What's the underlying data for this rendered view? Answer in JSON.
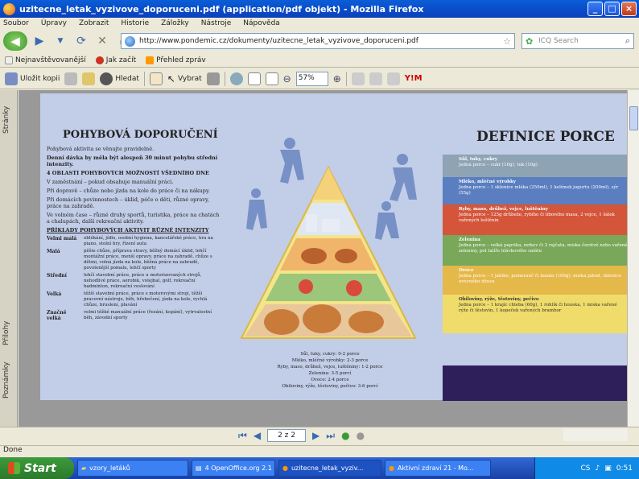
{
  "window": {
    "title": "uzitecne_letak_vyzivove_doporuceni.pdf (application/pdf objekt) - Mozilla Firefox",
    "controls": [
      "_",
      "□",
      "×"
    ]
  },
  "menu": [
    "Soubor",
    "Úpravy",
    "Zobrazit",
    "Historie",
    "Záložky",
    "Nástroje",
    "Nápověda"
  ],
  "nav": {
    "url": "http://www.pondemic.cz/dokumenty/uzitecne_letak_vyzivove_doporuceni.pdf",
    "search_placeholder": "ICQ Search"
  },
  "bookmarks": [
    "Nejnavštěvovanější",
    "Jak začít",
    "Přehled zpráv"
  ],
  "pdf_toolbar": {
    "save_copy": "Uložit kopii",
    "search": "Hledat",
    "select": "Vybrat",
    "zoom": "57%"
  },
  "sidebar_tabs": [
    "Stránky",
    "Přílohy",
    "Poznámky"
  ],
  "pager": {
    "page": "2 z 2"
  },
  "status": "Done",
  "pdf": {
    "left_heading": "POHYBOVÁ DOPORUČENÍ",
    "left_intro": [
      "Pohybová aktivita se věnujte pravidelně.",
      "Denní dávka by měla být alespoň 30 minut pohybu střední intenzity."
    ],
    "left_oblasti_title": "4 OBLASTI POHYBOVÝCH MOŽNOSTÍ VŠEDNÍHO DNE",
    "left_oblasti": [
      "V zaměstnání – pokud obsahuje manuální práci.",
      "Při dopravě – chůze nebo jízda na kole do práce či na nákupy.",
      "Při domácích povinnostech – úklid, péče o děti, různé opravy, práce na zahradě.",
      "Ve volném čase – různé druhy sportů, turistika, práce na chatách a chalupách, další rekreační aktivity."
    ],
    "left_examples_title": "PŘÍKLADY POHYBOVÝCH AKTIVIT RŮZNÉ INTENZITY",
    "activities": [
      {
        "k": "Velmi malá",
        "v": "oblékání, jídlo, osobní hygiena, kancelářské práce, hra na piano, stolní hry, řízení auta"
      },
      {
        "k": "Malá",
        "v": "pěšie chůze, příprava stravy, běžný domácí úklid, lehčí montážní práce, menší opravy, práce na zahradě, chůze s dětmi, volná jízda na kole, běžná práce na zahradě, povolenější pomalu, lehčí sporty"
      },
      {
        "k": "Střední",
        "v": "lehčí stavební práce, práce u motorizovaných strojů, nehodlivé práce, aerobik, volejbal, golf, rekreační badminton, rekreační veslování"
      },
      {
        "k": "Velká",
        "v": "těžší stavební práce, práce s motorovými stroji, těžší pracovní nástroje, běh, hřebečení, jízda na kole, rychlá chůze, bruslení, plavání"
      },
      {
        "k": "Značně velká",
        "v": "velmi těžké manuální práce (řezání, kopání), vytrvalostní běh, závodní sporty"
      }
    ],
    "pyramid_caption": [
      "Sůl, tuky, cukry: 0-2 porce",
      "Mléko, mléčné výrobky: 2-3 porce",
      "Ryby, maso, drůbež, vejce, luštěniny: 1-2 porce",
      "Zelenina: 3-5 porcí",
      "Ovoce: 2-4 porce",
      "Obiloviny, rýže, těstoviny, pečivo: 3-6 porcí"
    ],
    "right_heading": "DEFINICE PORCE",
    "bands": [
      {
        "title": "Sůl, tuky, cukry",
        "text": "Jedna porce – cukr (10g), tuk (10g)",
        "color": "#8ea3b4"
      },
      {
        "title": "Mléko, mléčné výrobky",
        "text": "Jedna porce – 1 sklenice mléka (250ml), 1 kelímek jogurtu (200ml), sýr (55g)",
        "color": "#5a7ec0"
      },
      {
        "title": "Ryby, maso, drůbež, vejce, luštěniny",
        "text": "Jedna porce – 125g drůbeže, rybího či libového masa, 2 vejce, 1 šálek vařených luštěnin",
        "color": "#d4553a"
      },
      {
        "title": "Zelenina",
        "text": "Jedna porce – velká paprika, mrkev či 2 rajčata, miska čerstvé nebo vařené zeleniny, pol talíře hlávkového salátu",
        "color": "#79a85a"
      },
      {
        "title": "Ovoce",
        "text": "Jedna porce – 1 jablko, pomeranč či banán (100g), miska jahod, sklenice ovocného džusu",
        "color": "#e5b84a"
      },
      {
        "title": "Obiloviny, rýže, těstoviny, pečivo",
        "text": "Jedna porce – 1 krajíc chleba (60g), 1 rohlík či houska, 1 miska vařené rýže či těstovin, 1 kopeček vařených brambor",
        "color": "#f0dc6a"
      }
    ]
  },
  "taskbar": {
    "start": "Start",
    "tasks": [
      "vzory_letáků",
      "4 OpenOffice.org 2.1",
      "uzitecne_letak_vyziv...",
      "Aktivní zdraví 21 - Mo..."
    ],
    "lang": "CS",
    "time": "0:51"
  }
}
